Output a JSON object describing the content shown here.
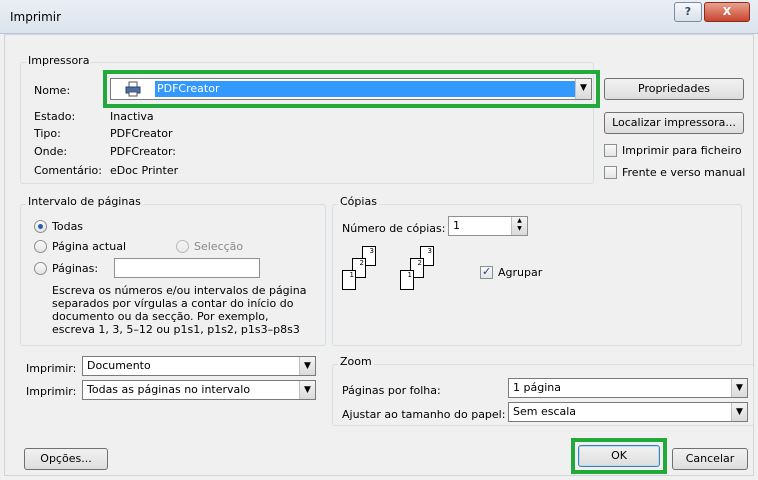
{
  "window": {
    "title": "Imprimir",
    "help_glyph": "?",
    "close_glyph": "X"
  },
  "printer": {
    "group_label": "Impressora",
    "name_label": "Nome:",
    "name_value": "PDFCreator",
    "state_label": "Estado:",
    "state_value": "Inactiva",
    "type_label": "Tipo:",
    "type_value": "PDFCreator",
    "where_label": "Onde:",
    "where_value": "PDFCreator:",
    "comment_label": "Comentário:",
    "comment_value": "eDoc Printer",
    "properties_button": "Propriedades",
    "find_button": "Localizar impressora...",
    "print_to_file_label": "Imprimir para ficheiro",
    "duplex_label": "Frente e verso manual",
    "print_to_file_checked": false,
    "duplex_checked": false
  },
  "range": {
    "group_label": "Intervalo de páginas",
    "all_label": "Todas",
    "current_label": "Página actual",
    "selection_label": "Selecção",
    "pages_label": "Páginas:",
    "pages_value": "",
    "selected": "all",
    "help_text_lines": [
      "Escreva os números e/ou intervalos de página",
      "separados por vírgulas a contar do início do",
      "documento ou da secção. Por exemplo,",
      "escreva 1, 3, 5–12 ou p1s1, p1s2, p1s3–p8s3"
    ]
  },
  "copies": {
    "group_label": "Cópias",
    "count_label": "Número de cópias:",
    "count_value": "1",
    "collate_label": "Agrupar",
    "collate_checked": true,
    "page_numbers": [
      "3",
      "2",
      "1"
    ]
  },
  "print_what": {
    "label": "Imprimir:",
    "value": "Documento"
  },
  "print_pages": {
    "label": "Imprimir:",
    "value": "Todas as páginas no intervalo"
  },
  "zoom": {
    "group_label": "Zoom",
    "pages_per_sheet_label": "Páginas por folha:",
    "pages_per_sheet_value": "1 página",
    "scale_label": "Ajustar ao tamanho do papel:",
    "scale_value": "Sem escala"
  },
  "buttons": {
    "options": "Opções...",
    "ok": "OK",
    "cancel": "Cancelar"
  },
  "colors": {
    "highlight": "#3399ff",
    "annotation_green": "#23a83a"
  }
}
